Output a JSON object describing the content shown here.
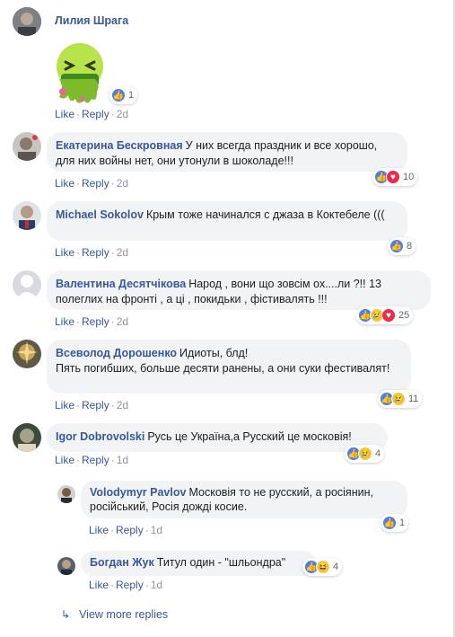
{
  "comments": [
    {
      "author": "Лилия Шрага",
      "text": "",
      "sticker": "sick-emoji-sticker",
      "reaction_count": "1",
      "like": "Like",
      "reply": "Reply",
      "time": "2d"
    },
    {
      "author": "Екатерина Бескровная",
      "text": "У них всегда праздник и все хорошо, для них войны нет, они утонули в шоколаде!!!",
      "reaction_count": "10",
      "like": "Like",
      "reply": "Reply",
      "time": "2d"
    },
    {
      "author": "Michael Sokolov",
      "text": "Крым тоже начинался с джаза в Коктебеле (((",
      "reaction_count": "8",
      "like": "Like",
      "reply": "Reply",
      "time": "2d"
    },
    {
      "author": "Валентина Десятчікова",
      "text": "Народ , вони що зовсім ох....ли ?!! 13 полеглих на фронті , а ці , покидьки , фістивалять !!!",
      "reaction_count": "25",
      "like": "Like",
      "reply": "Reply",
      "time": "2d"
    },
    {
      "author": "Всеволод Дорошенко",
      "text_line1": "Идиоты, блд!",
      "text_line2": "Пять погибших, больше десяти ранены, а они суки фестивалят!",
      "reaction_count": "11",
      "like": "Like",
      "reply": "Reply",
      "time": "2d"
    },
    {
      "author": "Igor Dobrovolski",
      "text": "Русь це Україна,а Русский це московія!",
      "reaction_count": "4",
      "like": "Like",
      "reply": "Reply",
      "time": "1d"
    }
  ],
  "replies": [
    {
      "author": "Volodymyr Pavlov",
      "text": "Московія то не русский, а росіянин, російський, Росія дожді косие.",
      "reaction_count": "1",
      "like": "Like",
      "reply": "Reply",
      "time": "1d"
    },
    {
      "author": "Богдан Жук",
      "text": "Титул один - \"шльондра\"",
      "reaction_count": "4",
      "like": "Like",
      "reply": "Reply",
      "time": "1d"
    }
  ],
  "view_more": "View more replies",
  "colors": {
    "link": "#385898",
    "bubble": "#f2f3f5",
    "meta": "#90949c",
    "like": "#4a7ef2",
    "love": "#f0284a"
  }
}
